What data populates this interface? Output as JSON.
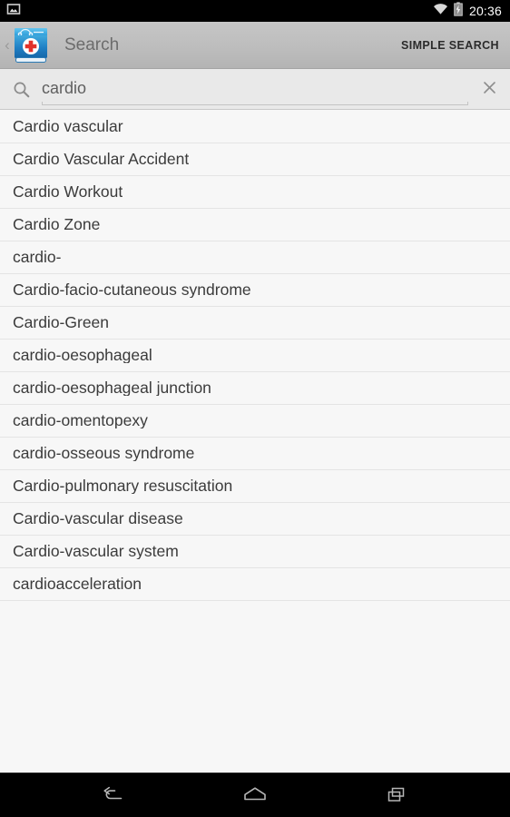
{
  "status_bar": {
    "notification_icon": "screenshot-image-icon",
    "wifi_icon": "wifi-icon",
    "battery_icon": "battery-charging-icon",
    "clock": "20:36",
    "background": "#000000",
    "text_color": "#ffffff"
  },
  "action_bar": {
    "up_chevron": "‹",
    "app_icon": "medical-dictionary-book-icon",
    "title": "Search",
    "action_label": "SIMPLE SEARCH",
    "background": "#bdbdbd",
    "title_color": "#6c6c6c",
    "action_color": "#2b2b2b"
  },
  "search": {
    "icon": "magnifier-icon",
    "value": "cardio",
    "placeholder": "Search",
    "clear_icon": "close-x-icon",
    "background": "#e9e9e9",
    "text_color": "#5f5f5f"
  },
  "suggestions": {
    "background": "#f7f7f7",
    "divider_color": "#e4e4e4",
    "text_color": "#3b3b3b",
    "items": [
      {
        "label": "Cardio vascular"
      },
      {
        "label": "Cardio Vascular Accident"
      },
      {
        "label": "Cardio Workout"
      },
      {
        "label": "Cardio Zone"
      },
      {
        "label": "cardio-"
      },
      {
        "label": "Cardio-facio-cutaneous syndrome"
      },
      {
        "label": "Cardio-Green"
      },
      {
        "label": "cardio-oesophageal"
      },
      {
        "label": "cardio-oesophageal junction"
      },
      {
        "label": "cardio-omentopexy"
      },
      {
        "label": "cardio-osseous syndrome"
      },
      {
        "label": "Cardio-pulmonary resuscitation"
      },
      {
        "label": "Cardio-vascular disease"
      },
      {
        "label": "Cardio-vascular system"
      },
      {
        "label": "cardioacceleration"
      }
    ]
  },
  "nav_bar": {
    "background": "#000000",
    "back_icon": "back-arrow-icon",
    "home_icon": "home-icon",
    "recents_icon": "recent-apps-icon"
  }
}
